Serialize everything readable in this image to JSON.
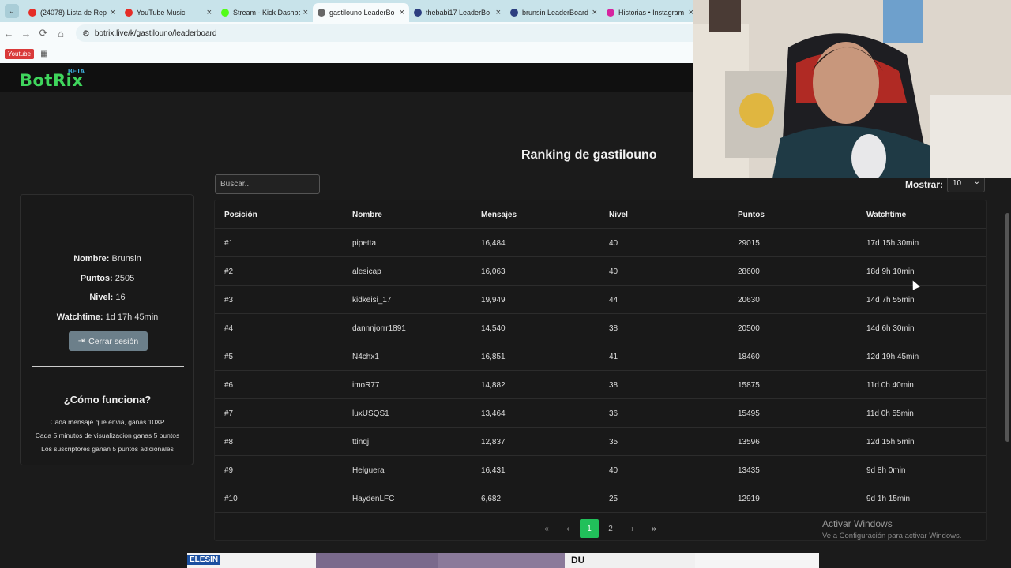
{
  "browser": {
    "tabs": [
      {
        "label": "(24078) Lista de Rep",
        "fav_color": "#e52d27"
      },
      {
        "label": "YouTube Music",
        "fav_color": "#e52d27"
      },
      {
        "label": "Stream - Kick Dashbo",
        "fav_color": "#53fc18"
      },
      {
        "label": "gastilouno LeaderBo",
        "fav_color": "#666666",
        "active": true
      },
      {
        "label": "thebabi17 LeaderBo",
        "fav_color": "#2c3e80"
      },
      {
        "label": "brunsin LeaderBoard",
        "fav_color": "#2c3e80"
      },
      {
        "label": "Historias • Instagram",
        "fav_color": "#d6249f"
      }
    ],
    "url": "botrix.live/k/gastilouno/leaderboard",
    "bookmark": "Youtube"
  },
  "site": {
    "logo": "BotRix",
    "beta": "BETA",
    "title": "Ranking de gastilouno",
    "search_placeholder": "Buscar...",
    "show_label": "Mostrar:",
    "show_value": "10"
  },
  "profile": {
    "name_label": "Nombre:",
    "name_value": "Brunsin",
    "points_label": "Puntos:",
    "points_value": "2505",
    "level_label": "Nivel:",
    "level_value": "16",
    "watch_label": "Watchtime:",
    "watch_value": "1d 17h 45min",
    "logout": "Cerrar sesión",
    "how_title": "¿Cómo funciona?",
    "how_lines": [
      "Cada mensaje que envia, ganas 10XP",
      "Cada 5 minutos de visualizacion ganas 5 puntos",
      "Los suscriptores ganan 5 puntos adicionales"
    ]
  },
  "table": {
    "headers": [
      "Posición",
      "Nombre",
      "Mensajes",
      "Nivel",
      "Puntos",
      "Watchtime"
    ],
    "rows": [
      [
        "#1",
        "pipetta",
        "16,484",
        "40",
        "29015",
        "17d 15h 30min"
      ],
      [
        "#2",
        "alesicap",
        "16,063",
        "40",
        "28600",
        "18d 9h 10min"
      ],
      [
        "#3",
        "kidkeisi_17",
        "19,949",
        "44",
        "20630",
        "14d 7h 55min"
      ],
      [
        "#4",
        "dannnjorrr1891",
        "14,540",
        "38",
        "20500",
        "14d 6h 30min"
      ],
      [
        "#5",
        "N4chx1",
        "16,851",
        "41",
        "18460",
        "12d 19h 45min"
      ],
      [
        "#6",
        "imoR77",
        "14,882",
        "38",
        "15875",
        "11d 0h 40min"
      ],
      [
        "#7",
        "luxUSQS1",
        "13,464",
        "36",
        "15495",
        "11d 0h 55min"
      ],
      [
        "#8",
        "ttinqj",
        "12,837",
        "35",
        "13596",
        "12d 15h 5min"
      ],
      [
        "#9",
        "Helguera",
        "16,431",
        "40",
        "13435",
        "9d 8h 0min"
      ],
      [
        "#10",
        "HaydenLFC",
        "6,682",
        "25",
        "12919",
        "9d 1h 15min"
      ]
    ],
    "pager": {
      "first": "«",
      "prev": "‹",
      "pages": [
        "1",
        "2"
      ],
      "next": "›",
      "last": "»",
      "current": "1"
    }
  },
  "windows": {
    "activate_title": "Activar Windows",
    "activate_sub": "Ve a Configuración para activar Windows."
  },
  "bottom": {
    "label": "ELESIN",
    "label2": "DU"
  }
}
